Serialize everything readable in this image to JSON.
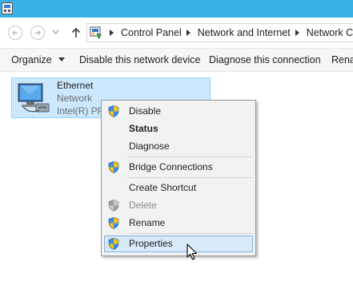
{
  "window": {
    "title_icon": "control-panel-window-icon"
  },
  "nav": {
    "back_icon": "back-arrow-icon",
    "forward_icon": "forward-arrow-icon",
    "recent_icon": "chevron-down-icon",
    "up_icon": "up-arrow-icon"
  },
  "address": {
    "icon": "control-panel-icon",
    "crumbs": [
      "Control Panel",
      "Network and Internet",
      "Network Co"
    ]
  },
  "toolbar": {
    "organize": "Organize",
    "disable": "Disable this network device",
    "diagnose": "Diagnose this connection",
    "rename": "Rena"
  },
  "adapter": {
    "name": "Ethernet",
    "status": "Network",
    "device": "Intel(R) PR"
  },
  "context_menu": {
    "items": [
      {
        "label": "Disable",
        "icon": "uac-shield-icon"
      },
      {
        "label": "Status"
      },
      {
        "label": "Diagnose"
      },
      {
        "label": "Bridge Connections",
        "icon": "uac-shield-icon"
      },
      {
        "label": "Create Shortcut"
      },
      {
        "label": "Delete",
        "icon": "uac-shield-icon",
        "state": "disabled"
      },
      {
        "label": "Rename",
        "icon": "uac-shield-icon"
      },
      {
        "label": "Properties",
        "icon": "uac-shield-icon",
        "state": "hovered"
      }
    ]
  },
  "colors": {
    "titlebar": "#39b2e8",
    "selection": "#cce8ff",
    "selection_border": "#99d1ff",
    "menu_highlight": "#d8eaf9"
  }
}
